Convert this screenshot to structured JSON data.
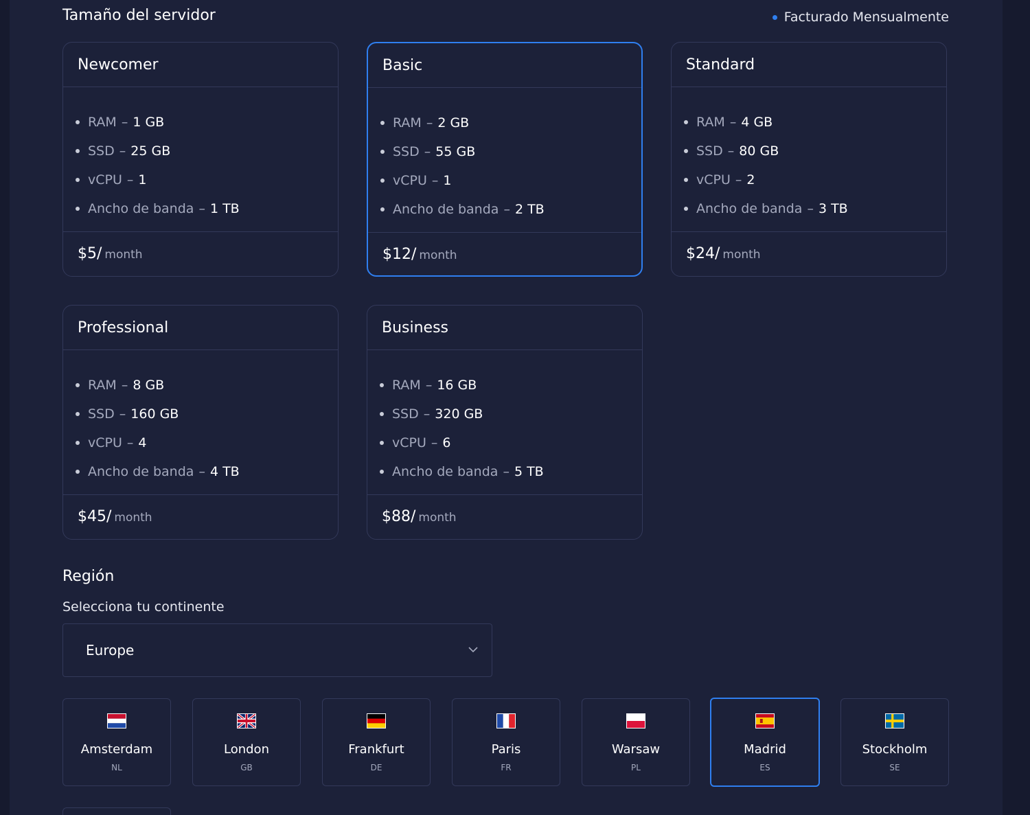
{
  "server_size": {
    "title": "Tamaño del servidor",
    "billing": "Facturado Mensualmente"
  },
  "plans": [
    {
      "name": "Newcomer",
      "specs": [
        {
          "key": "RAM",
          "value": "1 GB"
        },
        {
          "key": "SSD",
          "value": "25 GB"
        },
        {
          "key": "vCPU",
          "value": "1"
        },
        {
          "key": "Ancho de banda",
          "value": "1 TB"
        }
      ],
      "price": "$5/",
      "period": "month",
      "selected": false
    },
    {
      "name": "Basic",
      "specs": [
        {
          "key": "RAM",
          "value": "2 GB"
        },
        {
          "key": "SSD",
          "value": "55 GB"
        },
        {
          "key": "vCPU",
          "value": "1"
        },
        {
          "key": "Ancho de banda",
          "value": "2 TB"
        }
      ],
      "price": "$12/",
      "period": "month",
      "selected": true
    },
    {
      "name": "Standard",
      "specs": [
        {
          "key": "RAM",
          "value": "4 GB"
        },
        {
          "key": "SSD",
          "value": "80 GB"
        },
        {
          "key": "vCPU",
          "value": "2"
        },
        {
          "key": "Ancho de banda",
          "value": "3 TB"
        }
      ],
      "price": "$24/",
      "period": "month",
      "selected": false
    },
    {
      "name": "Professional",
      "specs": [
        {
          "key": "RAM",
          "value": "8 GB"
        },
        {
          "key": "SSD",
          "value": "160 GB"
        },
        {
          "key": "vCPU",
          "value": "4"
        },
        {
          "key": "Ancho de banda",
          "value": "4 TB"
        }
      ],
      "price": "$45/",
      "period": "month",
      "selected": false
    },
    {
      "name": "Business",
      "specs": [
        {
          "key": "RAM",
          "value": "16 GB"
        },
        {
          "key": "SSD",
          "value": "320 GB"
        },
        {
          "key": "vCPU",
          "value": "6"
        },
        {
          "key": "Ancho de banda",
          "value": "5 TB"
        }
      ],
      "price": "$88/",
      "period": "month",
      "selected": false
    }
  ],
  "spec_separator": "–",
  "region": {
    "title": "Región",
    "continent_label": "Selecciona tu continente",
    "continent_value": "Europe",
    "chevron_icon": "chevron-down-icon"
  },
  "locations": [
    {
      "city": "Amsterdam",
      "code": "NL",
      "flag_icon": "flag-netherlands-icon",
      "selected": false
    },
    {
      "city": "London",
      "code": "GB",
      "flag_icon": "flag-united-kingdom-icon",
      "selected": false
    },
    {
      "city": "Frankfurt",
      "code": "DE",
      "flag_icon": "flag-germany-icon",
      "selected": false
    },
    {
      "city": "Paris",
      "code": "FR",
      "flag_icon": "flag-france-icon",
      "selected": false
    },
    {
      "city": "Warsaw",
      "code": "PL",
      "flag_icon": "flag-poland-icon",
      "selected": false
    },
    {
      "city": "Madrid",
      "code": "ES",
      "flag_icon": "flag-spain-icon",
      "selected": true
    },
    {
      "city": "Stockholm",
      "code": "SE",
      "flag_icon": "flag-sweden-icon",
      "selected": false
    }
  ],
  "colors": {
    "accent": "#2f7ff0",
    "background": "#1c2139",
    "border": "#33395a",
    "muted_text": "#a4a9bd"
  }
}
